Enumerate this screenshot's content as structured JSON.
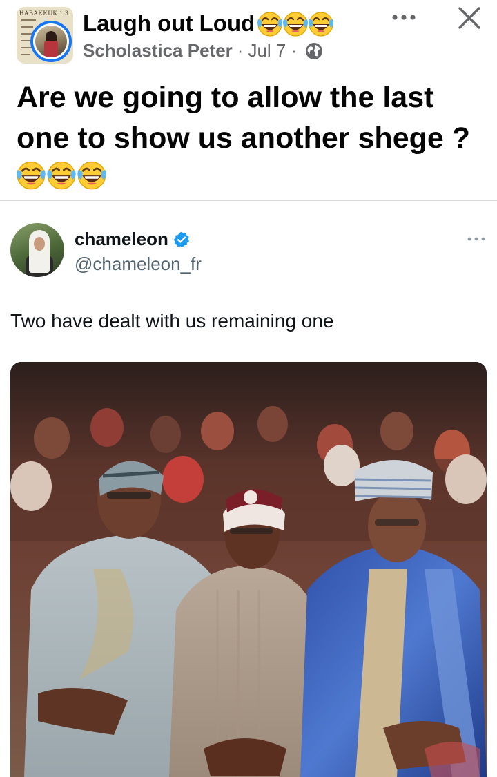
{
  "post": {
    "group_name": "Laugh out Loud",
    "group_emoji_count": 3,
    "author_name": "Scholastica Peter",
    "separator": "·",
    "date": "Jul 7",
    "privacy_icon": "globe-icon",
    "more_icon": "more-horizontal-icon",
    "close_icon": "close-icon",
    "group_avatar_text": "HABAKKUK 1:3",
    "caption": "Are we going to allow the last one to show us another shege ?",
    "caption_emoji_count": 3,
    "emoji_icon": "face-with-tears-of-joy-icon"
  },
  "tweet": {
    "display_name": "chameleon",
    "verified": true,
    "verified_icon": "verified-badge-icon",
    "handle": "@chameleon_fr",
    "text": "Two have dealt with us remaining one",
    "more_icon": "more-horizontal-icon",
    "photo": {
      "description_icon": "photo-image",
      "people_count": 3
    }
  },
  "colors": {
    "primary_text": "#050505",
    "secondary_text": "#65676b",
    "facebook_blue": "#1877f2",
    "twitter_verified": "#1d9bf0",
    "tweet_text": "#0f1419",
    "tweet_secondary": "#536471",
    "divider": "#d9dadc"
  }
}
